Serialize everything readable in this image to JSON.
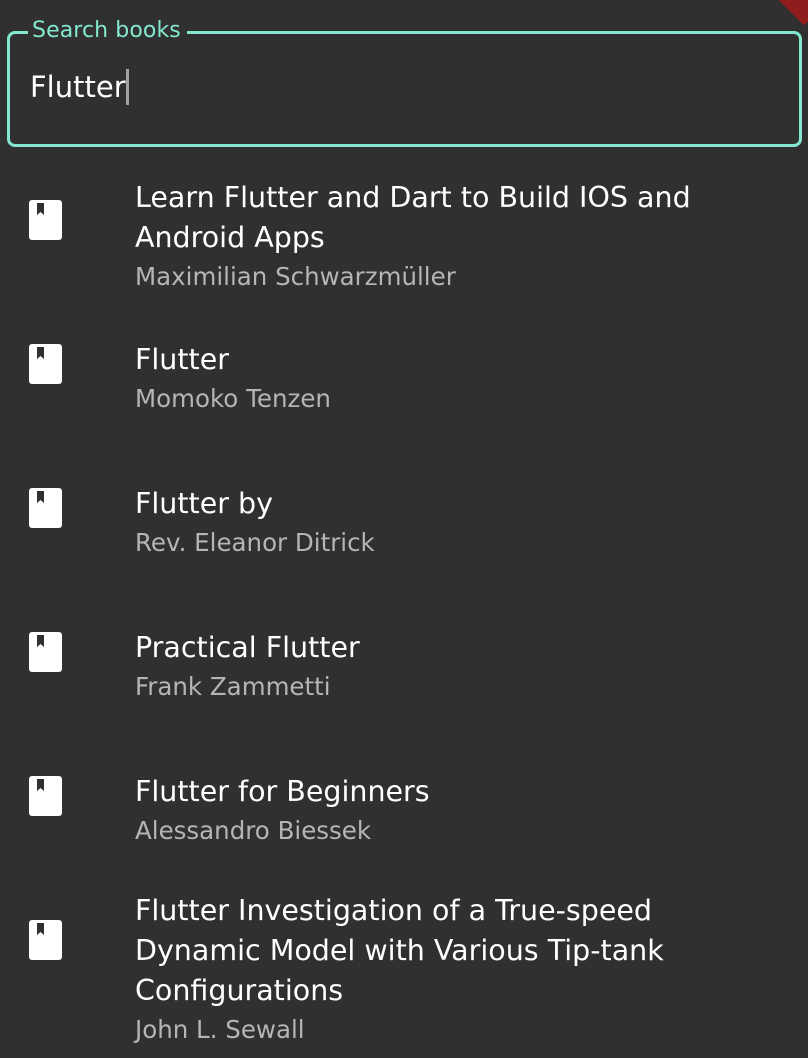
{
  "search": {
    "label": "Search books",
    "value": "Flutter"
  },
  "results": [
    {
      "title": "Learn Flutter and Dart to Build IOS and Android Apps",
      "author": "Maximilian Schwarzmüller",
      "icon": "book-icon"
    },
    {
      "title": "Flutter",
      "author": "Momoko Tenzen",
      "icon": "book-icon"
    },
    {
      "title": "Flutter by",
      "author": "Rev. Eleanor Ditrick",
      "icon": "book-icon"
    },
    {
      "title": "Practical Flutter",
      "author": "Frank Zammetti",
      "icon": "book-icon"
    },
    {
      "title": "Flutter for Beginners",
      "author": "Alessandro Biessek",
      "icon": "book-icon"
    },
    {
      "title": "Flutter Investigation of a True-speed Dynamic Model with Various Tip-tank Configurations",
      "author": "John L. Sewall",
      "icon": "book-icon"
    }
  ],
  "colors": {
    "background": "#303030",
    "accent": "#83e8cf",
    "primary_text": "#ffffff",
    "secondary_text": "#b5b5b5"
  }
}
